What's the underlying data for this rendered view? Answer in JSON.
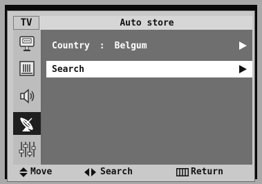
{
  "header": {
    "source_tag": "TV",
    "title": "Auto store"
  },
  "sidebar": {
    "items": [
      {
        "name": "picture-icon",
        "active": false
      },
      {
        "name": "sound-icon",
        "active": false
      },
      {
        "name": "speaker-icon",
        "active": false
      },
      {
        "name": "channel-antenna-icon",
        "active": true
      },
      {
        "name": "setup-sliders-icon",
        "active": false
      }
    ]
  },
  "menu": {
    "country_label": "Country",
    "country_separator": ":",
    "country_value": "Belgum",
    "search_label": "Search"
  },
  "footer": {
    "move_label": "Move",
    "search_label": "Search",
    "return_label": "Return"
  },
  "colors": {
    "panel_bg": "#c9c9c9",
    "content_bg": "#6f6f6f",
    "highlight_bg": "#ffffff",
    "active_icon_bg": "#1f1f1f"
  }
}
